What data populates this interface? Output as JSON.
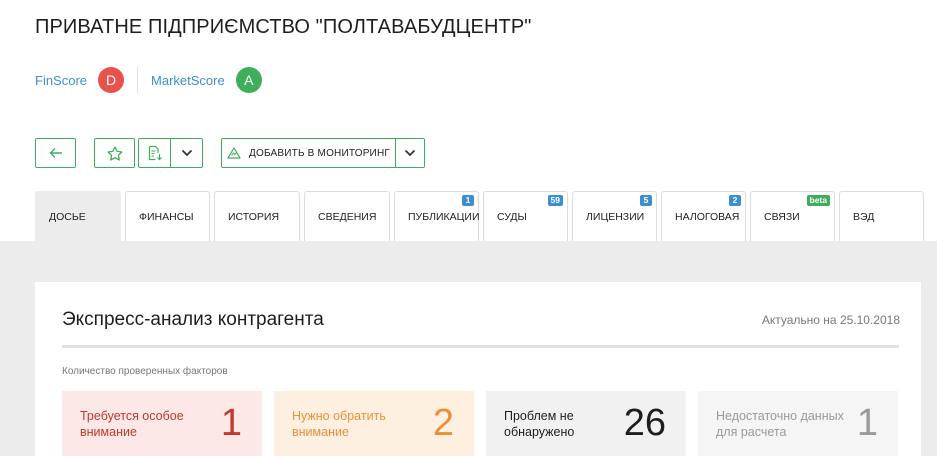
{
  "company": {
    "title": "ПРИВАТНЕ ПІДПРИЄМСТВО \"ПОЛТАВАБУДЦЕНТР\""
  },
  "scores": [
    {
      "label": "FinScore",
      "grade": "D",
      "color": "#e8524a"
    },
    {
      "label": "MarketScore",
      "grade": "A",
      "color": "#3fae5a"
    }
  ],
  "toolbar": {
    "back_icon": "arrow-left-icon",
    "favorite_icon": "star-icon",
    "export_icon": "document-download-icon",
    "monitor_icon": "monitoring-icon",
    "monitor_label": "ДОБАВИТЬ В МОНИТОРИНГ",
    "accent": "#3fae5a"
  },
  "tabs": [
    {
      "label": "ДОСЬЕ",
      "badge": "",
      "active": true
    },
    {
      "label": "ФИНАНСЫ",
      "badge": ""
    },
    {
      "label": "ИСТОРИЯ",
      "badge": ""
    },
    {
      "label": "СВЕДЕНИЯ",
      "badge": ""
    },
    {
      "label": "ПУБЛИКАЦИИ",
      "badge": "1"
    },
    {
      "label": "СУДЫ",
      "badge": "59"
    },
    {
      "label": "ЛИЦЕНЗИИ",
      "badge": "5"
    },
    {
      "label": "НАЛОГОВАЯ",
      "badge": "2"
    },
    {
      "label": "СВЯЗИ",
      "badge": "beta"
    },
    {
      "label": "ВЭД",
      "badge": ""
    }
  ],
  "analysis": {
    "title": "Экспресс-анализ контрагента",
    "date": "Актуально на 25.10.2018",
    "subtitle": "Количество проверенных факторов",
    "stats": [
      {
        "label": "Требуется особое внимание",
        "value": "1",
        "bg": "#fde8e8",
        "color": "#c0392b"
      },
      {
        "label": "Нужно обратить внимание",
        "value": "2",
        "bg": "#fdf0e1",
        "color": "#e8913a"
      },
      {
        "label": "Проблем не обнаружено",
        "value": "26",
        "bg": "#f1f1f1",
        "color": "#1e1e1e"
      },
      {
        "label": "Недостаточно данных для расчета",
        "value": "1",
        "bg": "#f5f5f5",
        "color": "#9a9a9a"
      }
    ]
  }
}
